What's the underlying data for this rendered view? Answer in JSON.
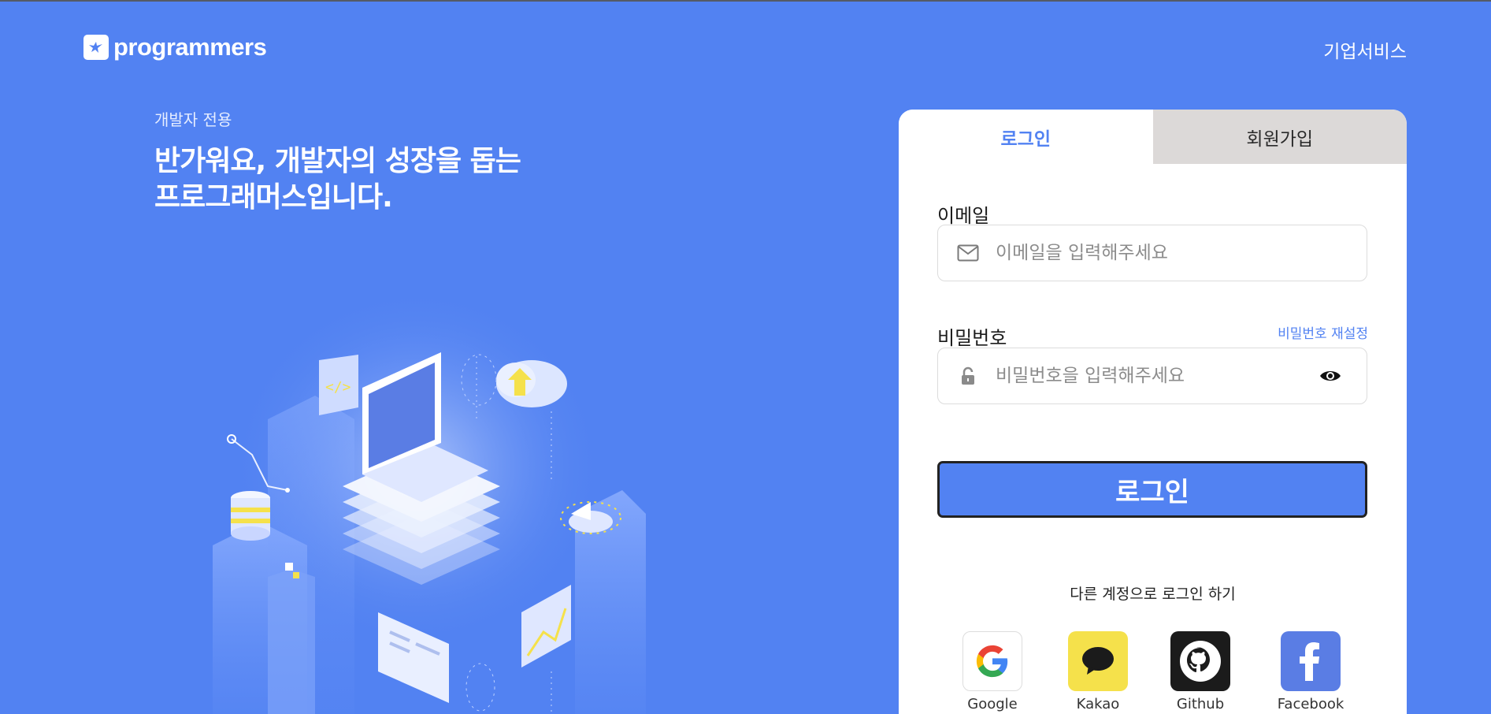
{
  "header": {
    "logo_text": "programmers",
    "enterprise_link": "기업서비스"
  },
  "hero": {
    "subtitle": "개발자 전용",
    "title_line1": "반가워요, 개발자의 성장을 돕는",
    "title_line2": "프로그래머스입니다."
  },
  "login": {
    "tabs": [
      "로그인",
      "회원가입"
    ],
    "email_label": "이메일",
    "email_placeholder": "이메일을 입력해주세요",
    "password_label": "비밀번호",
    "password_placeholder": "비밀번호을 입력해주세요",
    "reset_password": "비밀번호 재설정",
    "submit": "로그인",
    "other_login": "다른 계정으로 로그인 하기",
    "social": [
      "Google",
      "Kakao",
      "Github",
      "Facebook"
    ]
  },
  "colors": {
    "brand": "#5282f2",
    "kakao": "#f5e14b",
    "github": "#1b1b1b",
    "facebook": "#5a7de4"
  }
}
